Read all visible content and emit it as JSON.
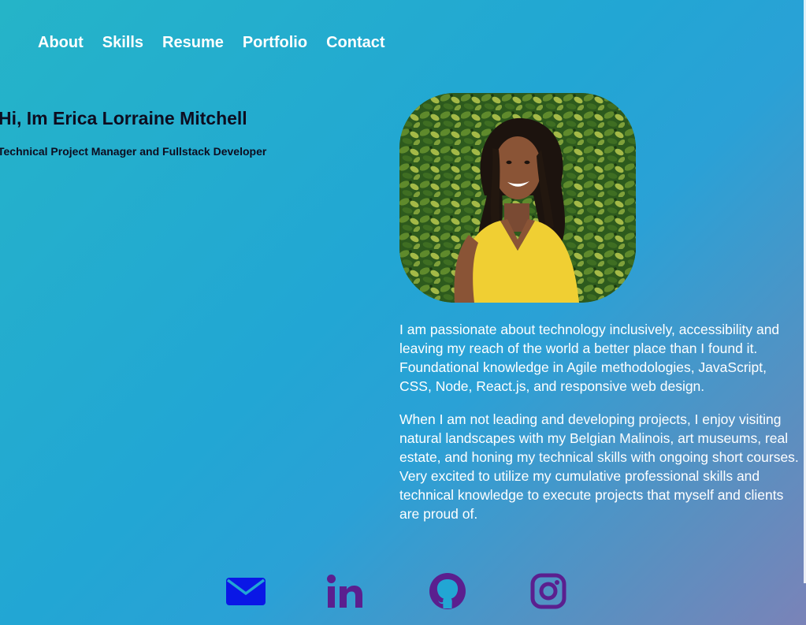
{
  "nav": {
    "items": [
      {
        "label": "About"
      },
      {
        "label": "Skills"
      },
      {
        "label": "Resume"
      },
      {
        "label": "Portfolio"
      },
      {
        "label": "Contact"
      }
    ]
  },
  "hero": {
    "title": "Hi, Im Erica Lorraine Mitchell",
    "subtitle": "Technical Project Manager and Fullstack Developer"
  },
  "profile_photo": {
    "alt": "Portrait of Erica Lorraine Mitchell"
  },
  "bio": {
    "paragraphs": [
      "I am passionate about technology inclusively, accessibility and leaving my reach of the world a better place than I found it. Foundational knowledge in Agile methodologies, JavaScript, CSS, Node, React.js, and responsive web design.",
      "When I am not leading and developing projects, I enjoy visiting natural landscapes with my Belgian Malinois, art museums, real estate, and honing my technical skills with ongoing short courses. Very excited to utilize my cumulative professional skills and technical knowledge to execute projects that myself and clients are proud of."
    ]
  },
  "socials": [
    {
      "icon": "envelope-icon",
      "color": "#0a17e6"
    },
    {
      "icon": "linkedin-icon",
      "color": "#5b1f8f"
    },
    {
      "icon": "github-icon",
      "color": "#5b1f8f"
    },
    {
      "icon": "instagram-icon",
      "color": "#5b1f8f"
    }
  ],
  "colors": {
    "nav_text": "#ffffff",
    "heading_text": "#0d0d20",
    "bio_text": "#ffffff"
  }
}
